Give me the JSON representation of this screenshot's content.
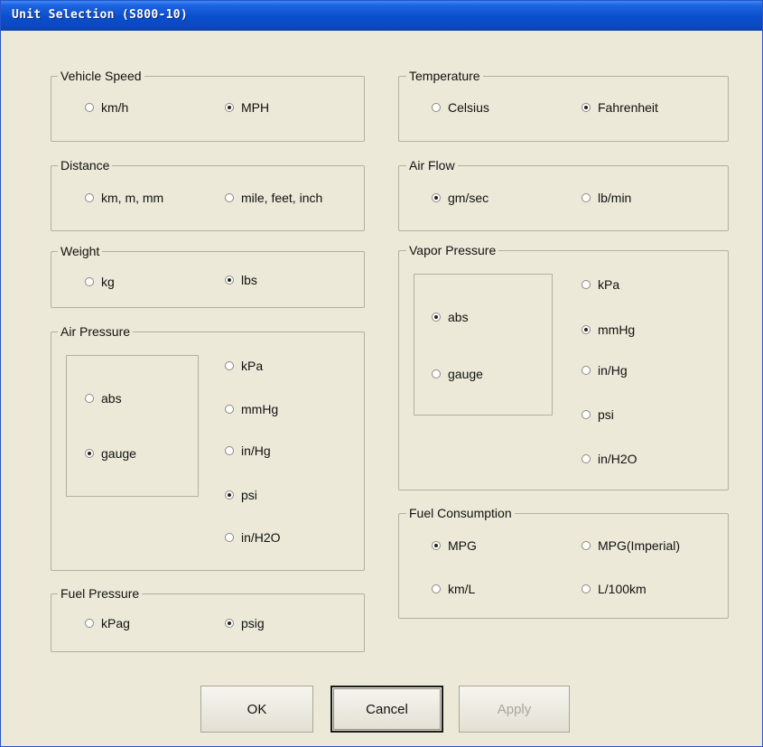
{
  "window": {
    "title": "Unit Selection (S800-10)"
  },
  "groups": {
    "vehicle_speed": {
      "label": "Vehicle Speed",
      "options": [
        {
          "label": "km/h",
          "checked": false
        },
        {
          "label": "MPH",
          "checked": true
        }
      ]
    },
    "distance": {
      "label": "Distance",
      "options": [
        {
          "label": "km, m, mm",
          "checked": false
        },
        {
          "label": "mile, feet, inch",
          "checked": false
        }
      ]
    },
    "weight": {
      "label": "Weight",
      "options": [
        {
          "label": "kg",
          "checked": false
        },
        {
          "label": "lbs",
          "checked": true
        }
      ]
    },
    "air_pressure": {
      "label": "Air Pressure",
      "modes": [
        {
          "label": "abs",
          "checked": false
        },
        {
          "label": "gauge",
          "checked": true
        }
      ],
      "units": [
        {
          "label": "kPa",
          "checked": false
        },
        {
          "label": "mmHg",
          "checked": false
        },
        {
          "label": "in/Hg",
          "checked": false
        },
        {
          "label": "psi",
          "checked": true
        },
        {
          "label": "in/H2O",
          "checked": false
        }
      ]
    },
    "fuel_pressure": {
      "label": "Fuel Pressure",
      "options": [
        {
          "label": "kPag",
          "checked": false
        },
        {
          "label": "psig",
          "checked": true
        }
      ]
    },
    "temperature": {
      "label": "Temperature",
      "options": [
        {
          "label": "Celsius",
          "checked": false
        },
        {
          "label": "Fahrenheit",
          "checked": true
        }
      ]
    },
    "air_flow": {
      "label": "Air Flow",
      "options": [
        {
          "label": "gm/sec",
          "checked": true
        },
        {
          "label": "lb/min",
          "checked": false
        }
      ]
    },
    "vapor_pressure": {
      "label": "Vapor Pressure",
      "modes": [
        {
          "label": "abs",
          "checked": true
        },
        {
          "label": "gauge",
          "checked": false
        }
      ],
      "units": [
        {
          "label": "kPa",
          "checked": false
        },
        {
          "label": "mmHg",
          "checked": true
        },
        {
          "label": "in/Hg",
          "checked": false
        },
        {
          "label": "psi",
          "checked": false
        },
        {
          "label": "in/H2O",
          "checked": false
        }
      ]
    },
    "fuel_consumption": {
      "label": "Fuel Consumption",
      "options": [
        {
          "label": "MPG",
          "checked": true
        },
        {
          "label": "MPG(Imperial)",
          "checked": false
        },
        {
          "label": "km/L",
          "checked": false
        },
        {
          "label": "L/100km",
          "checked": false
        }
      ]
    }
  },
  "buttons": {
    "ok": "OK",
    "cancel": "Cancel",
    "apply": "Apply",
    "apply_enabled": false
  }
}
